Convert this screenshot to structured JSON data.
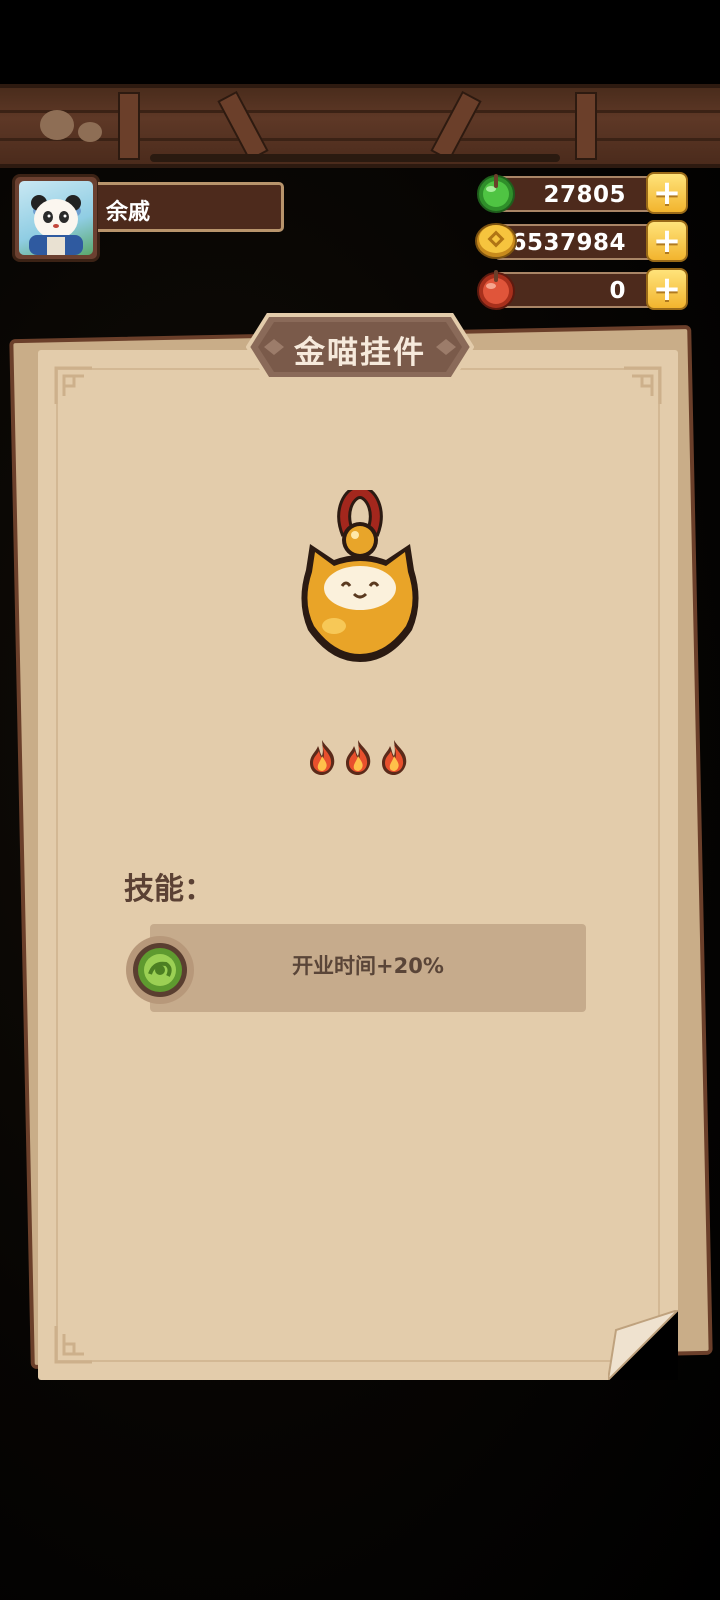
{
  "player": {
    "name": "余戚",
    "avatar_icon": "panda-character-avatar"
  },
  "currencies": [
    {
      "icon": "green-jade-icon",
      "value": "27805",
      "color": "#3fae3a"
    },
    {
      "icon": "gold-coin-icon",
      "value": "6537984",
      "color": "#e0a827"
    },
    {
      "icon": "red-jade-icon",
      "value": "0",
      "color": "#d0432a"
    }
  ],
  "panel": {
    "title": "金喵挂件",
    "item_icon": "golden-cat-pendant-icon",
    "star_count": 3,
    "star_icon": "flame-icon",
    "skill_label": "技能：",
    "skill_icon": "green-jade-skill-icon",
    "skill_text": "开业时间+20%"
  },
  "colors": {
    "paper": "#e3ccab",
    "wood": "#4d2a1c",
    "accent_gold": "#f2b42e"
  }
}
